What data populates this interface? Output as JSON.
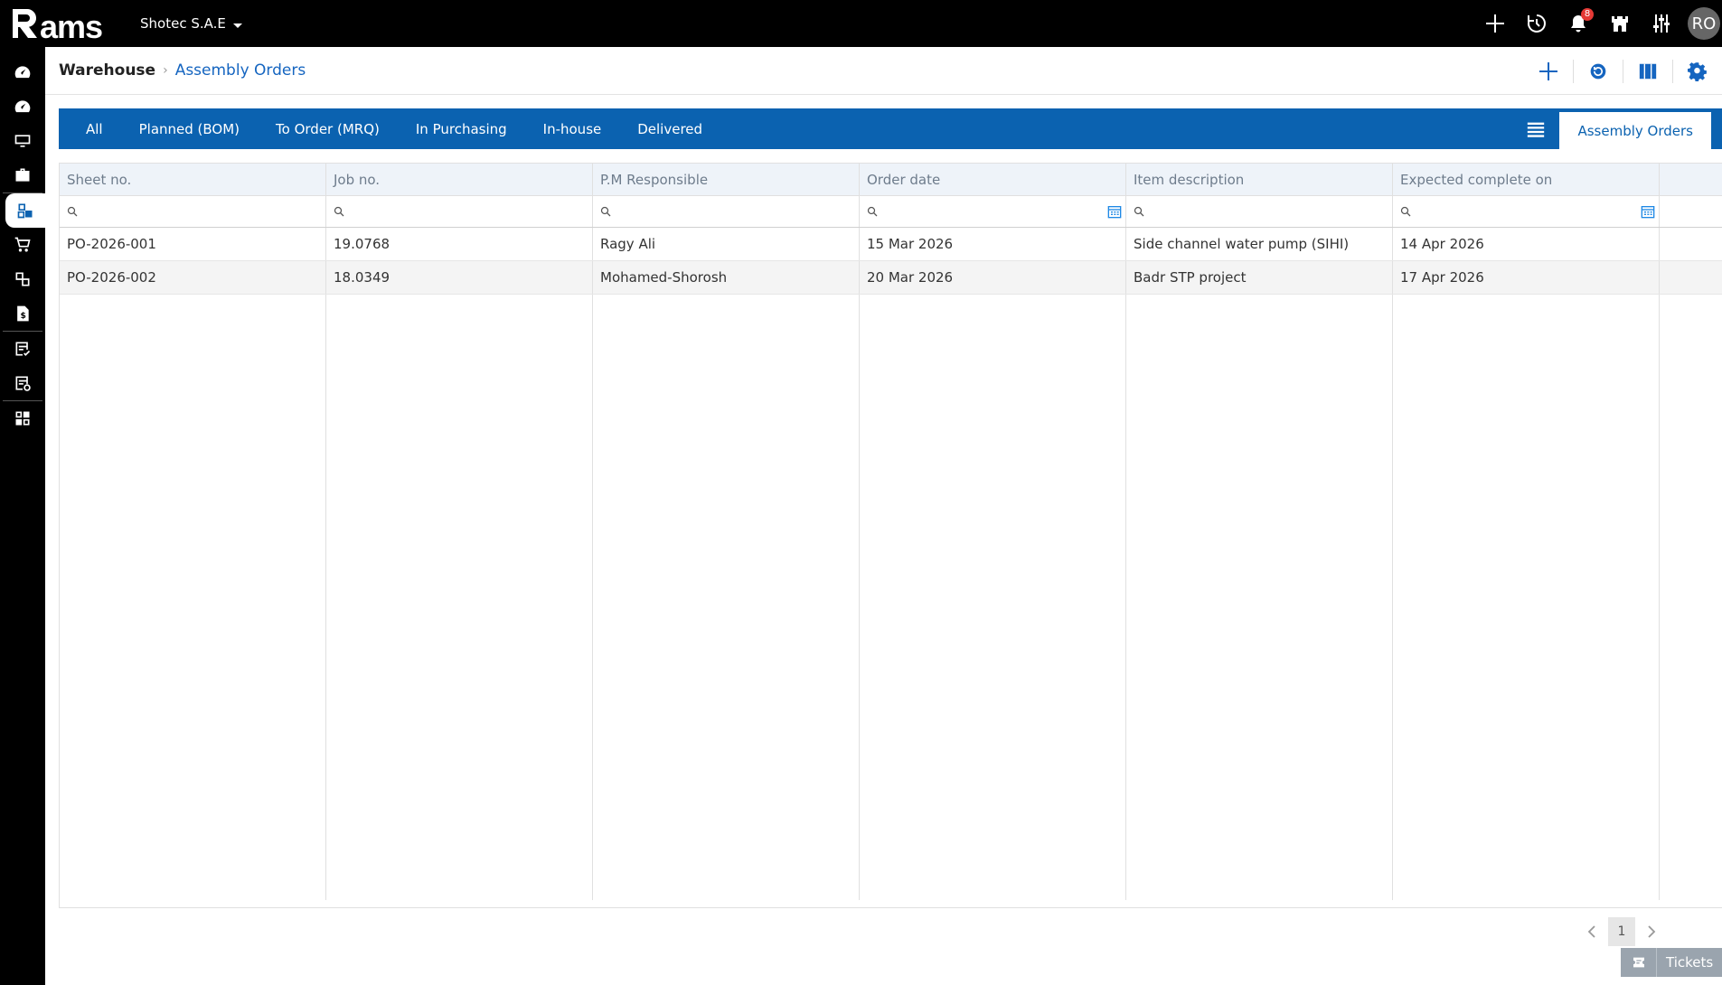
{
  "app": {
    "logo": "rams",
    "company": "Shotec S.A.E"
  },
  "topbar": {
    "notification_count": "8",
    "user_initials": "RO"
  },
  "breadcrumb": {
    "root": "Warehouse",
    "current": "Assembly Orders"
  },
  "tabs": [
    {
      "label": "All"
    },
    {
      "label": "Planned (BOM)"
    },
    {
      "label": "To Order (MRQ)"
    },
    {
      "label": "In Purchasing"
    },
    {
      "label": "In-house"
    },
    {
      "label": "Delivered"
    }
  ],
  "active_tab": "Assembly Orders",
  "columns": [
    "Sheet no.",
    "Job no.",
    "P.M Responsible",
    "Order date",
    "Item description",
    "Expected complete on"
  ],
  "filters": {
    "sheet_no": "",
    "job_no": "",
    "pm": "",
    "order_date": "",
    "item_desc": "",
    "expected": ""
  },
  "rows": [
    {
      "sheet_no": "PO-2026-001",
      "job_no": "19.0768",
      "pm": "Ragy Ali",
      "order_date": "15 Mar 2026",
      "item_desc": "Side channel water pump (SIHI)",
      "expected": "14 Apr 2026"
    },
    {
      "sheet_no": "PO-2026-002",
      "job_no": "18.0349",
      "pm": "Mohamed-Shorosh",
      "order_date": "20 Mar 2026",
      "item_desc": "Badr STP project",
      "expected": "17 Apr 2026"
    }
  ],
  "pagination": {
    "current_page": "1"
  },
  "tickets": {
    "label": "Tickets"
  },
  "colors": {
    "primary": "#0b62b0",
    "header_bg": "#000000",
    "link": "#1565c0",
    "badge": "#e53935"
  },
  "icons": {
    "topbar": [
      "plus-icon",
      "history-icon",
      "bell-icon",
      "castle-icon",
      "sliders-icon"
    ],
    "sidebar": [
      "dashboard-icon",
      "dashboard-icon",
      "monitor-icon",
      "briefcase-icon",
      "warehouse-icon",
      "cart-icon",
      "boxes-icon",
      "invoice-icon",
      "document-check-icon",
      "document-settings-icon",
      "grid-tiles-icon"
    ],
    "header": [
      "add-icon",
      "refresh-icon",
      "columns-icon",
      "gear-icon"
    ]
  }
}
